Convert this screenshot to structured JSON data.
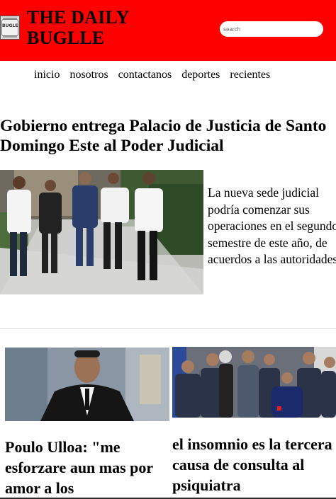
{
  "header": {
    "title": "THE DAILY BUGLLE",
    "logo_text": "BUGLE",
    "search_placeholder": "search",
    "background_color": "#ff0000"
  },
  "nav": {
    "items": [
      "inicio",
      "nosotros",
      "contactanos",
      "deportes",
      "recientes"
    ]
  },
  "main_article": {
    "headline": "Gobierno entrega Palacio de Justicia de Santo Domingo Este al Poder Judicial",
    "summary": "La nueva sede judicial podría comenzar sus operaciones en el segundo semestre de este año, de acuerdos a las autoridades."
  },
  "cards": [
    {
      "title": "Poulo Ulloa: \"me esforzare aun mas por amor a los"
    },
    {
      "title": "el insomnio es la tercera causa de consulta al psiquiatra"
    }
  ],
  "icons": {
    "logo": "newspaper-logo-icon"
  }
}
